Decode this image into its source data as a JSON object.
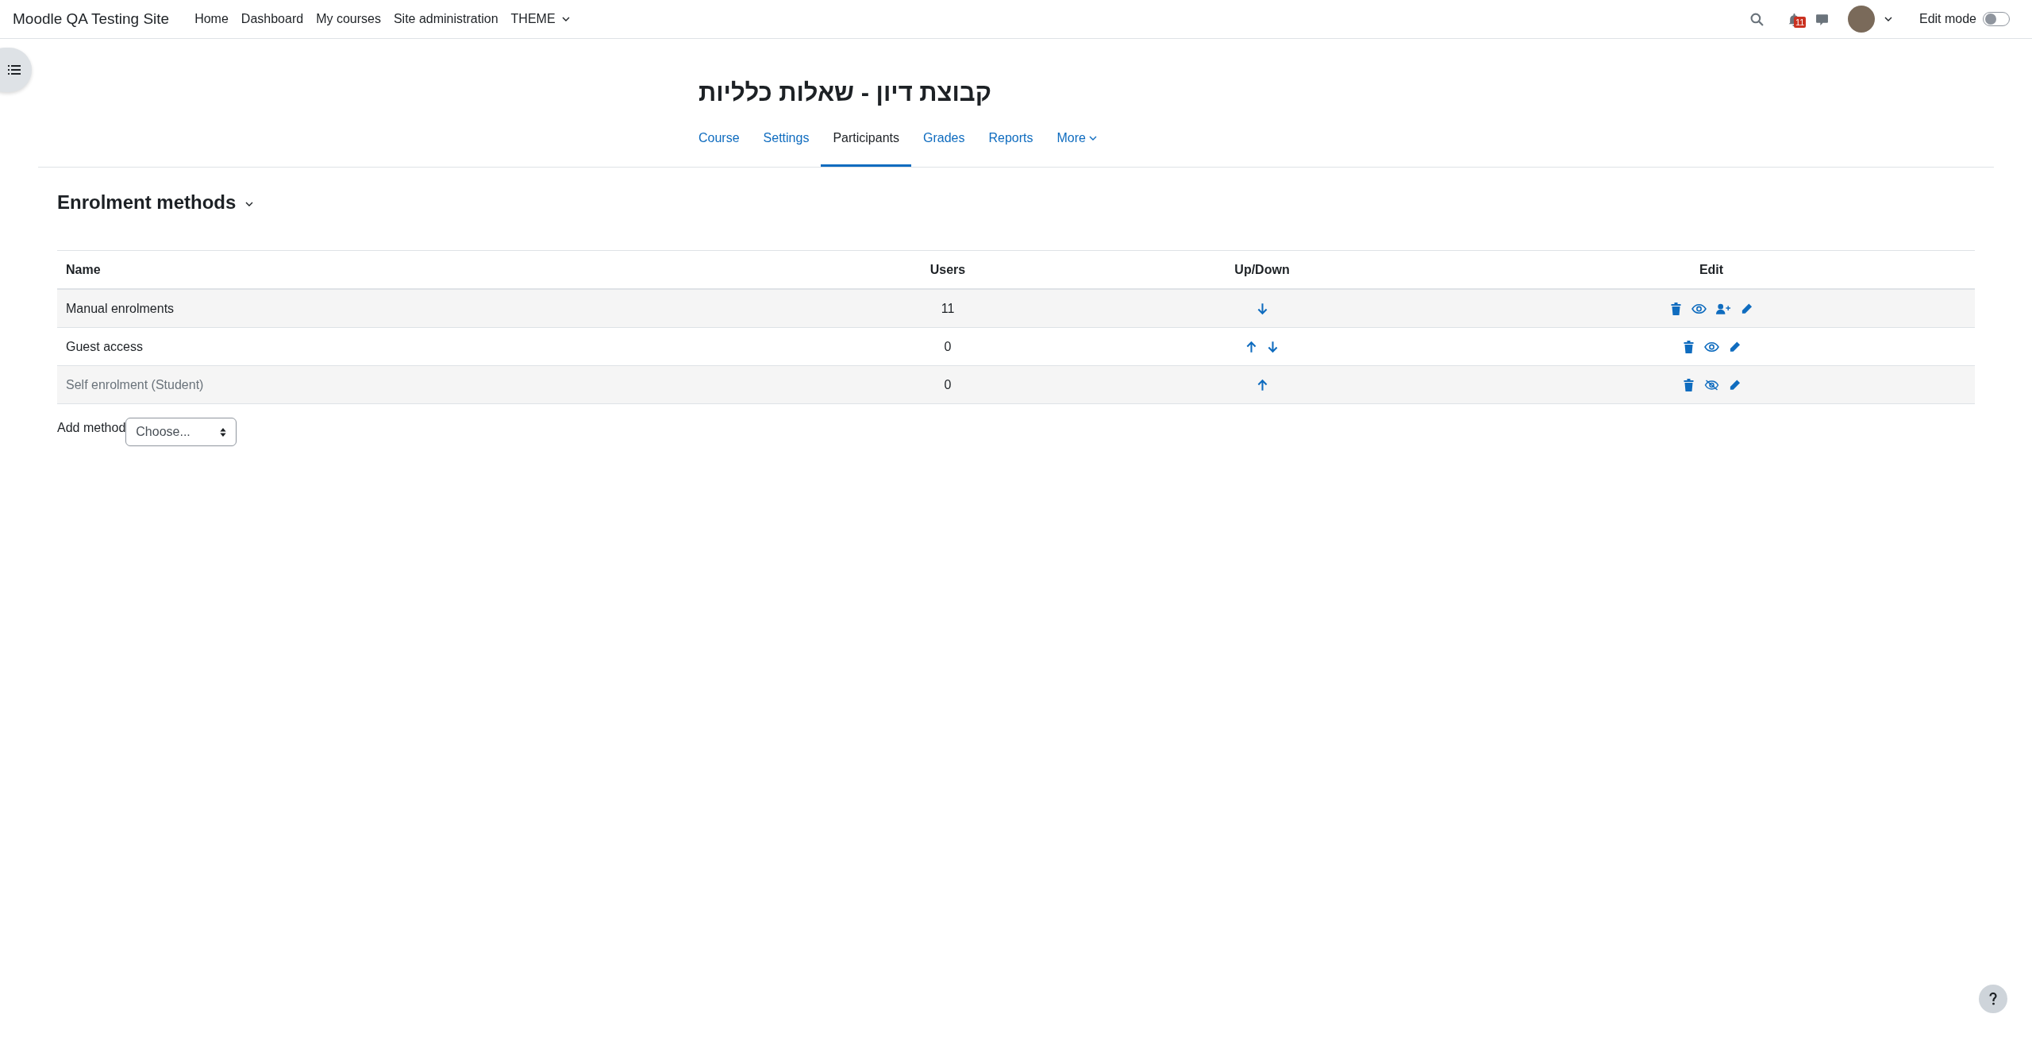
{
  "navbar": {
    "site_name": "Moodle QA Testing Site",
    "links": [
      {
        "label": "Home",
        "dropdown": false
      },
      {
        "label": "Dashboard",
        "dropdown": false
      },
      {
        "label": "My courses",
        "dropdown": false
      },
      {
        "label": "Site administration",
        "dropdown": false
      },
      {
        "label": "THEME",
        "dropdown": true
      }
    ],
    "notification_count": "11",
    "edit_mode": {
      "label": "Edit mode",
      "on": false
    }
  },
  "page": {
    "title": "קבוצת דיון - שאלות כלליות",
    "tabs": [
      {
        "label": "Course",
        "selected": false,
        "dropdown": false
      },
      {
        "label": "Settings",
        "selected": false,
        "dropdown": false
      },
      {
        "label": "Participants",
        "selected": true,
        "dropdown": false
      },
      {
        "label": "Grades",
        "selected": false,
        "dropdown": false
      },
      {
        "label": "Reports",
        "selected": false,
        "dropdown": false
      },
      {
        "label": "More",
        "selected": false,
        "dropdown": true
      }
    ],
    "heading": "Enrolment methods",
    "table": {
      "columns": [
        "Name",
        "Users",
        "Up/Down",
        "Edit"
      ],
      "rows": [
        {
          "name": "Manual enrolments",
          "users": "11",
          "enabled": true,
          "up": false,
          "down": true,
          "actions": [
            {
              "kind": "delete"
            },
            {
              "kind": "hide"
            },
            {
              "kind": "enrol"
            },
            {
              "kind": "edit"
            }
          ]
        },
        {
          "name": "Guest access",
          "users": "0",
          "enabled": true,
          "up": true,
          "down": true,
          "actions": [
            {
              "kind": "delete"
            },
            {
              "kind": "hide"
            },
            {
              "kind": "edit"
            }
          ]
        },
        {
          "name": "Self enrolment (Student)",
          "users": "0",
          "enabled": false,
          "up": true,
          "down": false,
          "actions": [
            {
              "kind": "delete"
            },
            {
              "kind": "show"
            },
            {
              "kind": "edit"
            }
          ]
        }
      ]
    },
    "add_method": {
      "label": "Add method",
      "value": "Choose..."
    }
  }
}
